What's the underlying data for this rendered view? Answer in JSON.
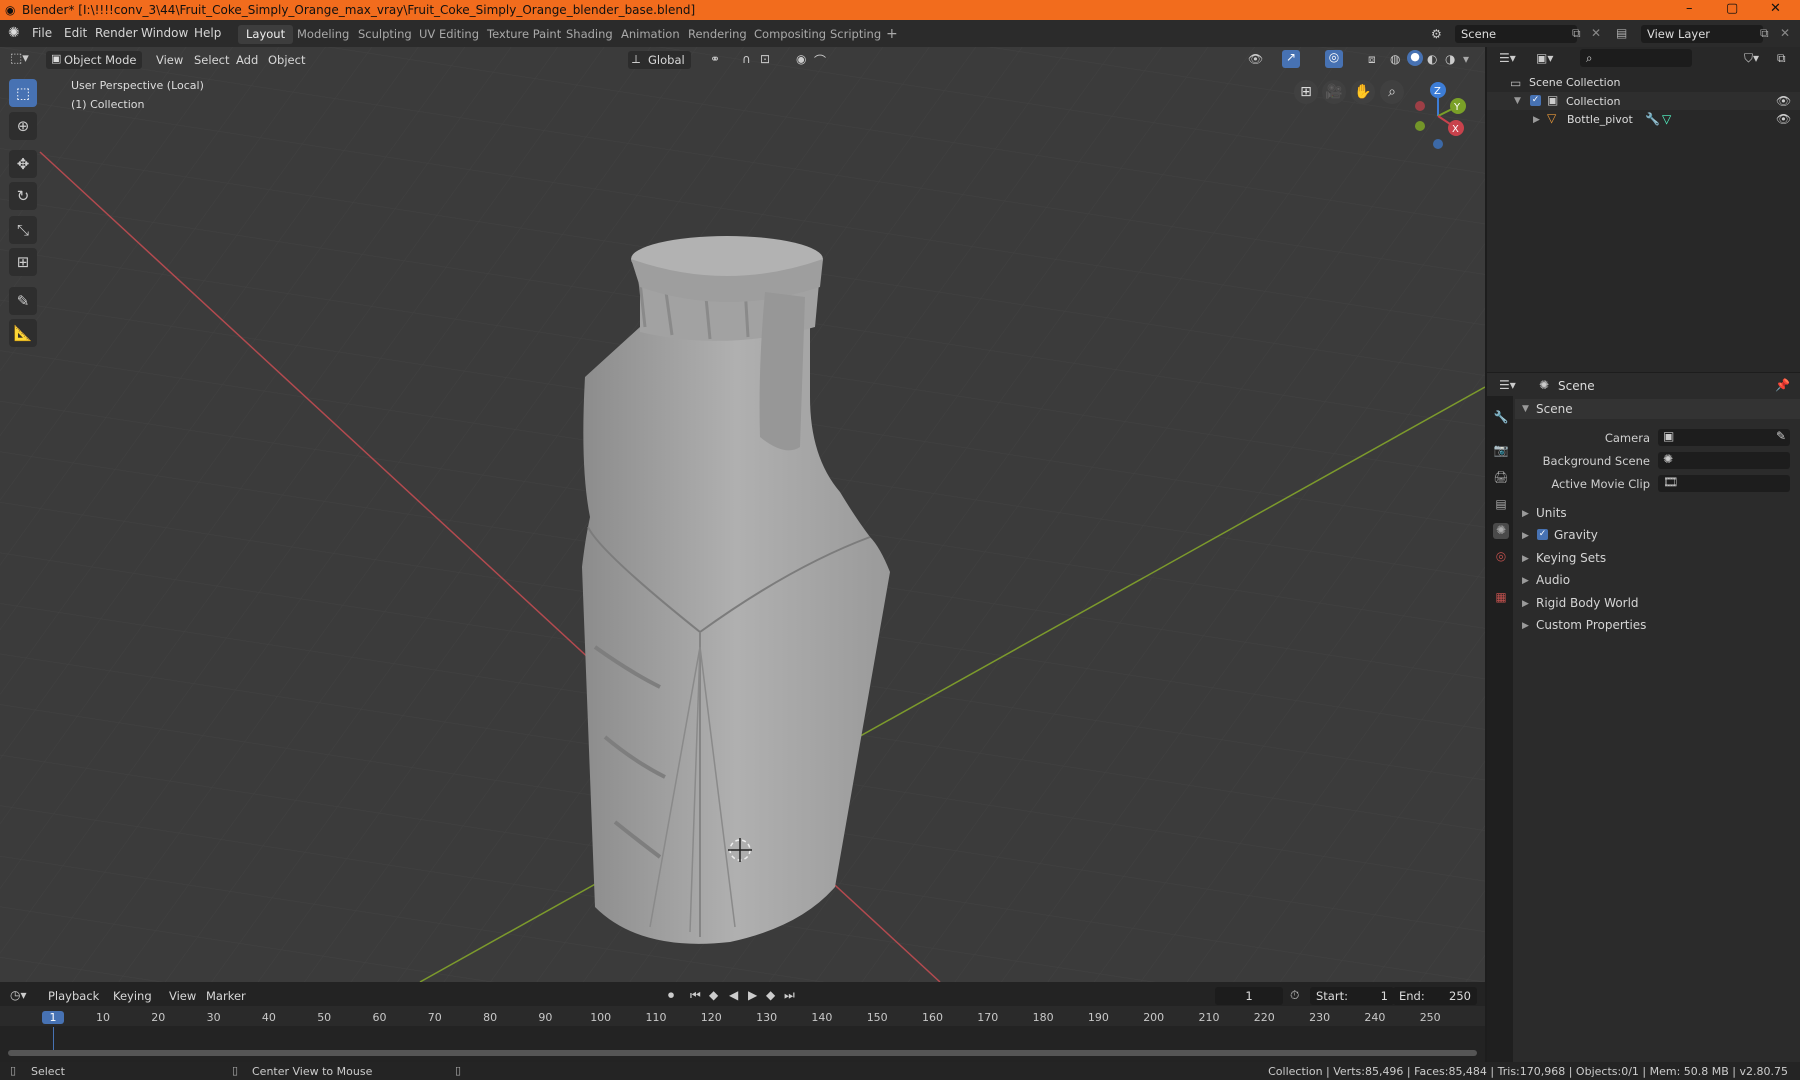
{
  "title_bar": {
    "text": "Blender* [I:\\!!!!conv_3\\44\\Fruit_Coke_Simply_Orange_max_vray\\Fruit_Coke_Simply_Orange_blender_base.blend]",
    "minimize": "–",
    "maximize": "▢",
    "close": "✕"
  },
  "menu": [
    "File",
    "Edit",
    "Render",
    "Window",
    "Help"
  ],
  "workspaces": [
    "Layout",
    "Modeling",
    "Sculpting",
    "UV Editing",
    "Texture Paint",
    "Shading",
    "Animation",
    "Rendering",
    "Compositing",
    "Scripting"
  ],
  "add_workspace": "+",
  "scene_field": "Scene",
  "view_layer_field": "View Layer",
  "viewport_header": {
    "mode": "Object Mode",
    "menus": [
      "View",
      "Select",
      "Add",
      "Object"
    ],
    "orientation": "Global"
  },
  "viewport_overlay": {
    "line1": "User Perspective (Local)",
    "line2": "(1) Collection"
  },
  "gizmo": {
    "z": "Z",
    "y": "Y",
    "x": "X"
  },
  "outliner": {
    "root": "Scene Collection",
    "collection": "Collection",
    "object": "Bottle_pivot"
  },
  "properties": {
    "header": "Scene",
    "section": "Scene",
    "fields": [
      {
        "label": "Camera"
      },
      {
        "label": "Background Scene"
      },
      {
        "label": "Active Movie Clip"
      }
    ],
    "subpanels": [
      "Units",
      "Gravity",
      "Keying Sets",
      "Audio",
      "Rigid Body World",
      "Custom Properties"
    ]
  },
  "timeline": {
    "menus": [
      "Playback",
      "Keying",
      "View",
      "Marker"
    ],
    "current_frame": "1",
    "start_label": "Start:",
    "start": "1",
    "end_label": "End:",
    "end": "250",
    "ruler": [
      "1",
      "10",
      "20",
      "30",
      "40",
      "50",
      "60",
      "70",
      "80",
      "90",
      "100",
      "110",
      "120",
      "130",
      "140",
      "150",
      "160",
      "170",
      "180",
      "190",
      "200",
      "210",
      "220",
      "230",
      "240",
      "250"
    ]
  },
  "status_bar": {
    "select": "Select",
    "center_view": "Center View to Mouse",
    "stats": "Collection | Verts:85,496 | Faces:85,484 | Tris:170,968 | Objects:0/1 | Mem: 50.8 MB | v2.80.75"
  },
  "colors": {
    "accent": "#4772b3",
    "title_bar": "#f26c1d",
    "x_axis": "#c8424c",
    "y_axis": "#7aa028",
    "z_axis": "#3d7dd6"
  }
}
